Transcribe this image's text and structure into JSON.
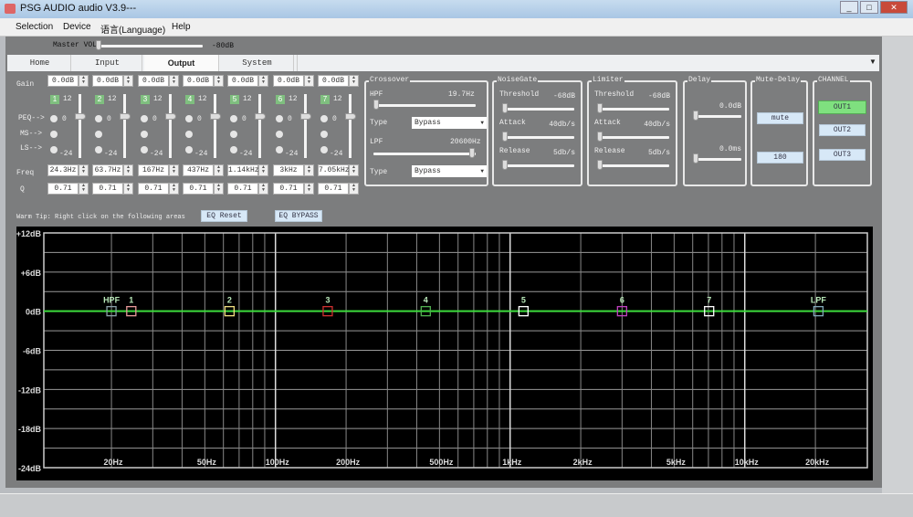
{
  "window": {
    "title": "PSG AUDIO audio V3.9---",
    "controls": [
      "_",
      "□",
      "✕"
    ]
  },
  "menu": [
    "Selection",
    "Device",
    "语言(Language)",
    "Help"
  ],
  "master": {
    "label": "Master VOL",
    "value": "-80dB",
    "level": 0
  },
  "tabs": [
    {
      "label": "Home"
    },
    {
      "label": "Input"
    },
    {
      "label": "Output",
      "selected": true
    },
    {
      "label": "System"
    }
  ],
  "eq": {
    "row_labels": {
      "gain": "Gain",
      "peq": "PEQ-->",
      "ms": "MS-->",
      "ls": "LS-->",
      "freq": "Freq",
      "q": "Q"
    },
    "scale": {
      "top": "12",
      "mid": "0",
      "bottom": "-24"
    },
    "bands": [
      {
        "num": "1",
        "gain": "0.0dB",
        "freq": "24.3Hz",
        "q": "0.71"
      },
      {
        "num": "2",
        "gain": "0.0dB",
        "freq": "63.7Hz",
        "q": "0.71"
      },
      {
        "num": "3",
        "gain": "0.0dB",
        "freq": "167Hz",
        "q": "0.71"
      },
      {
        "num": "4",
        "gain": "0.0dB",
        "freq": "437Hz",
        "q": "0.71"
      },
      {
        "num": "5",
        "gain": "0.0dB",
        "freq": "1.14kHz",
        "q": "0.71"
      },
      {
        "num": "6",
        "gain": "0.0dB",
        "freq": "3kHz",
        "q": "0.71"
      },
      {
        "num": "7",
        "gain": "0.0dB",
        "freq": "7.05kHz",
        "q": "0.71"
      }
    ],
    "tip": "Warm Tip: Right click on the following areas",
    "reset": "EQ Reset",
    "bypass": "EQ BYPASS"
  },
  "crossover": {
    "title": "Crossover",
    "hpf_label": "HPF",
    "hpf_value": "19.7Hz",
    "type_label": "Type",
    "hpf_type": "Bypass",
    "lpf_label": "LPF",
    "lpf_value": "20600Hz",
    "lpf_type": "Bypass"
  },
  "noisegate": {
    "title": "NoiseGate",
    "threshold_label": "Threshold",
    "threshold": "-68dB",
    "attack_label": "Attack",
    "attack": "40db/s",
    "release_label": "Release",
    "release": "5db/s"
  },
  "limiter": {
    "title": "Limiter",
    "threshold_label": "Threshold",
    "threshold": "-68dB",
    "attack_label": "Attack",
    "attack": "40db/s",
    "release_label": "Release",
    "release": "5db/s"
  },
  "delay": {
    "title": "Delay",
    "gain": "0.0dB",
    "time": "0.0ms"
  },
  "mute_delay": {
    "title": "Mute-Delay",
    "mute": "mute",
    "phase": "180"
  },
  "channel": {
    "title": "CHANNEL",
    "outputs": [
      {
        "label": "OUT1",
        "active": true
      },
      {
        "label": "OUT2"
      },
      {
        "label": "OUT3"
      }
    ],
    "active_color": "#7fe07f"
  },
  "chart_data": {
    "type": "line",
    "title": "",
    "xlabel": "",
    "ylabel": "",
    "xscale": "log",
    "xlim": [
      10.3,
      33300
    ],
    "ylim": [
      -24,
      12
    ],
    "grid": true,
    "yticks": [
      {
        "v": 12,
        "label": "+12dB"
      },
      {
        "v": 6,
        "label": "+6dB"
      },
      {
        "v": 0,
        "label": "0dB"
      },
      {
        "v": -6,
        "label": "-6dB"
      },
      {
        "v": -12,
        "label": "-12dB"
      },
      {
        "v": -18,
        "label": "-18dB"
      },
      {
        "v": -24,
        "label": "-24dB"
      }
    ],
    "xticks": [
      {
        "v": 20,
        "label": "20Hz"
      },
      {
        "v": 50,
        "label": "50Hz"
      },
      {
        "v": 100,
        "label": "100Hz"
      },
      {
        "v": 200,
        "label": "200Hz"
      },
      {
        "v": 500,
        "label": "500Hz"
      },
      {
        "v": 1000,
        "label": "1kHz"
      },
      {
        "v": 2000,
        "label": "2kHz"
      },
      {
        "v": 5000,
        "label": "5kHz"
      },
      {
        "v": 10000,
        "label": "10kHz"
      },
      {
        "v": 20000,
        "label": "20kHz"
      }
    ],
    "series": [
      {
        "name": "response",
        "color": "#3ddc3d",
        "x": [
          10.3,
          33300
        ],
        "y": [
          0,
          0
        ]
      }
    ],
    "markers": [
      {
        "label": "HPF",
        "freq": 20,
        "gain": 0,
        "color": "#8aa0a8"
      },
      {
        "label": "1",
        "freq": 24.3,
        "gain": 0,
        "color": "#e89a9a"
      },
      {
        "label": "2",
        "freq": 63.7,
        "gain": 0,
        "color": "#f0e080"
      },
      {
        "label": "3",
        "freq": 167,
        "gain": 0,
        "color": "#d03030"
      },
      {
        "label": "4",
        "freq": 437,
        "gain": 0,
        "color": "#50b050"
      },
      {
        "label": "5",
        "freq": 1140,
        "gain": 0,
        "color": "#ffffff"
      },
      {
        "label": "6",
        "freq": 3000,
        "gain": 0,
        "color": "#c040c0"
      },
      {
        "label": "7",
        "freq": 7050,
        "gain": 0,
        "color": "#ffffff"
      },
      {
        "label": "LPF",
        "freq": 20600,
        "gain": 0,
        "color": "#80a8b8"
      }
    ]
  }
}
